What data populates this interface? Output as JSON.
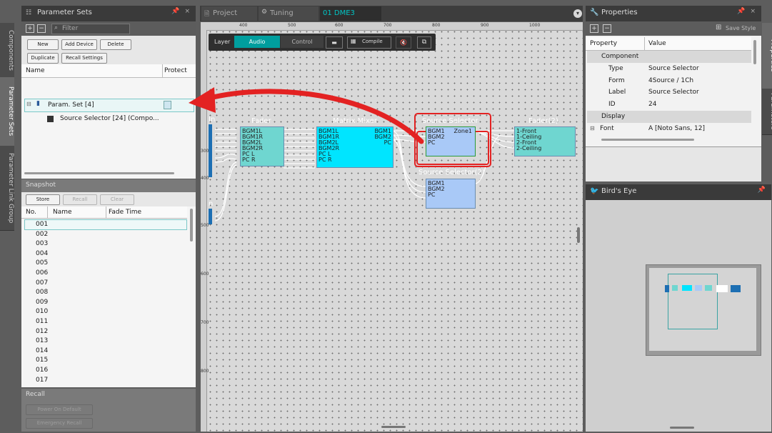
{
  "side_tabs": [
    "Components",
    "Parameter Sets",
    "Parameter Link Group"
  ],
  "right_tabs": [
    "Properties",
    "Parameters"
  ],
  "param_sets": {
    "title": "Parameter Sets",
    "filter_placeholder": "Filter",
    "buttons": [
      "New",
      "Add Device",
      "Delete",
      "Duplicate",
      "Recall Settings"
    ],
    "col_name": "Name",
    "col_protect": "Protect",
    "tree": [
      {
        "label": "Param. Set [4]"
      },
      {
        "label": "Source Selector [24] (Compo..."
      }
    ]
  },
  "snapshot": {
    "title": "Snapshot",
    "buttons": [
      "Store",
      "Recall",
      "Clear"
    ],
    "cols": [
      "No.",
      "Name",
      "Fade Time"
    ],
    "rows": [
      "001",
      "002",
      "003",
      "004",
      "005",
      "006",
      "007",
      "008",
      "009",
      "010",
      "011",
      "012",
      "013",
      "014",
      "015",
      "016",
      "017"
    ]
  },
  "recall": {
    "title": "Recall",
    "buttons": [
      "Power On Default",
      "Emergency Recall"
    ]
  },
  "tabs": [
    "Project",
    "Tuning",
    "01 DME3"
  ],
  "toolbar": {
    "layer": "Layer",
    "audio": "Audio",
    "control": "Control",
    "compile": "Compile"
  },
  "ruler": {
    "top": [
      "400",
      "500",
      "600",
      "700",
      "800",
      "900",
      "1000"
    ],
    "left": [
      "300",
      "400",
      "500",
      "600",
      "700",
      "800"
    ]
  },
  "canvas": {
    "in_label": "In",
    "in2_label": "n",
    "fader": {
      "title": "Fader",
      "ports": [
        "BGM1L",
        "BGM1R",
        "BGM2L",
        "BGM2R",
        "PC L",
        "PC R"
      ]
    },
    "matrix": {
      "title": "Matrix Mixer",
      "inputs": [
        "BGM1L",
        "BGM1R",
        "BGM2L",
        "BGM2R",
        "PC L",
        "PC R"
      ],
      "outputs": [
        "BGM1",
        "BGM2",
        "PC"
      ]
    },
    "ss1": {
      "title": "Source Selector",
      "inputs": [
        "BGM1",
        "BGM2",
        "PC"
      ],
      "output": "Zone1"
    },
    "ss2": {
      "title": "Source Selector(2)",
      "inputs": [
        "BGM1",
        "BGM2",
        "PC"
      ]
    },
    "fader2": {
      "title": "Fader(2)",
      "ports": [
        "1-Front",
        "1-Ceiling",
        "2-Front",
        "2-Ceiling"
      ]
    }
  },
  "properties": {
    "title": "Properties",
    "save_style": "Save Style",
    "col_property": "Property",
    "col_value": "Value",
    "rows": [
      {
        "k": "Component",
        "v": "",
        "group": true
      },
      {
        "k": "Type",
        "v": "Source Selector"
      },
      {
        "k": "Form",
        "v": "4Source / 1Ch"
      },
      {
        "k": "Label",
        "v": "Source Selector"
      },
      {
        "k": "ID",
        "v": "24"
      },
      {
        "k": "Display",
        "v": "",
        "group": true
      },
      {
        "k": "Font",
        "v": "A [Noto Sans, 12]"
      }
    ]
  },
  "birdseye": {
    "title": "Bird's Eye"
  },
  "colors": {
    "accent": "#00a0a0",
    "red": "#e32222",
    "matrix": "#00e5ff",
    "fader": "#6fd6d0",
    "selector": "#a9c9f7"
  }
}
